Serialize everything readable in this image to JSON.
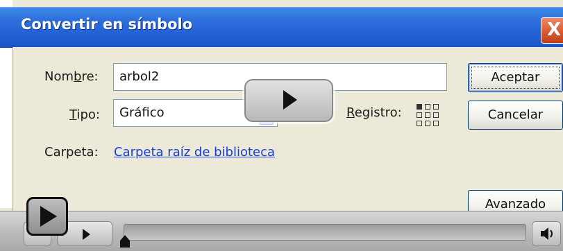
{
  "window": {
    "title": "Convertir en símbolo",
    "close_label": "X"
  },
  "form": {
    "name_label_pre": "Nom",
    "name_label_ul": "b",
    "name_label_post": "re:",
    "name_value": "arbol2",
    "type_label_ul": "T",
    "type_label_post": "ipo:",
    "type_value": "Gráfico",
    "registration_label_ul": "R",
    "registration_label_post": "egistro:",
    "folder_label": "Carpeta:",
    "folder_link": "Carpeta raíz de biblioteca"
  },
  "buttons": {
    "ok": "Aceptar",
    "cancel": "Cancelar",
    "advanced": "Avanzado"
  },
  "player": {
    "progress": 0.0,
    "icons": [
      "play-icon",
      "volume-icon"
    ]
  },
  "colors": {
    "titlebar": "#2160d4",
    "dialog_bg": "#ece9d8",
    "link": "#1a3fd8",
    "close": "#d85a32"
  }
}
